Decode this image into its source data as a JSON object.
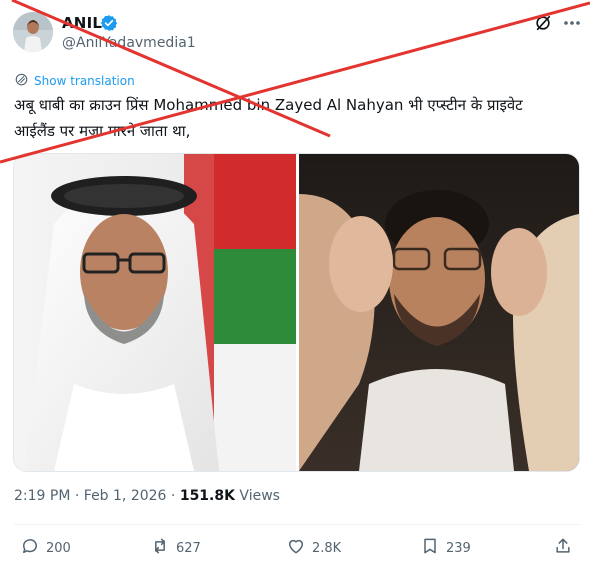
{
  "header": {
    "display_name": "ANIL",
    "handle": "@AnilYadavmedia1"
  },
  "translate": {
    "label": "Show translation",
    "icon": "globe-icon"
  },
  "tweet": {
    "line1": "अबू धाबी का क्राउन प्रिंस Mohammed bin Zayed Al Nahyan भी एप्स्टीन के प्राइवेट",
    "line2": "आईलैंड पर मज़ा मारने जाता था,"
  },
  "meta": {
    "time": "2:19 PM",
    "separator": " · ",
    "date": "Feb 1, 2026",
    "views_count": "151.8K",
    "views_label": " Views"
  },
  "actions": {
    "replies": "200",
    "reposts": "627",
    "likes": "2.8K",
    "bookmarks": "239"
  },
  "colors": {
    "accent": "#1d9bf0",
    "overlay_cross": "#e3342f",
    "text_secondary": "#536471"
  }
}
